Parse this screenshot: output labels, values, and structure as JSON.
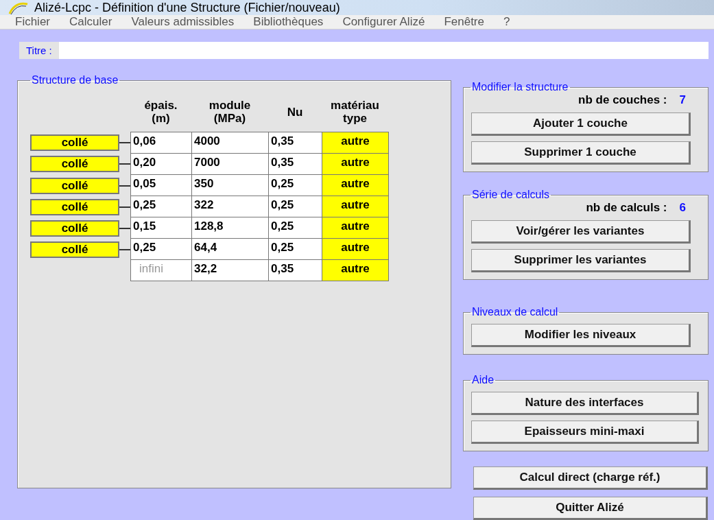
{
  "window": {
    "title": "Alizé-Lcpc - Définition d'une Structure (Fichier/nouveau)"
  },
  "menu": [
    "Fichier",
    "Calculer",
    "Valeurs admissibles",
    "Bibliothèques",
    "Configurer Alizé",
    "Fenêtre",
    "?"
  ],
  "title_field": {
    "label": "Titre :"
  },
  "structure": {
    "legend": "Structure de base",
    "columns": [
      {
        "line1": "épais.",
        "line2": "(m)"
      },
      {
        "line1": "module",
        "line2": "(MPa)"
      },
      {
        "line1": "Nu"
      },
      {
        "line1": "matériau",
        "line2": "type"
      }
    ],
    "layers": [
      {
        "thickness": "0,06",
        "disabled": false,
        "module": "4000",
        "nu": "0,35",
        "material": "autre"
      },
      {
        "thickness": "0,20",
        "disabled": false,
        "module": "7000",
        "nu": "0,35",
        "material": "autre"
      },
      {
        "thickness": "0,05",
        "disabled": false,
        "module": "350",
        "nu": "0,25",
        "material": "autre"
      },
      {
        "thickness": "0,25",
        "disabled": false,
        "module": "322",
        "nu": "0,25",
        "material": "autre"
      },
      {
        "thickness": "0,15",
        "disabled": false,
        "module": "128,8",
        "nu": "0,25",
        "material": "autre"
      },
      {
        "thickness": "0,25",
        "disabled": false,
        "module": "64,4",
        "nu": "0,25",
        "material": "autre"
      },
      {
        "thickness": "infini",
        "disabled": true,
        "module": "32,2",
        "nu": "0,35",
        "material": "autre"
      }
    ],
    "interfaces": [
      "collé",
      "collé",
      "collé",
      "collé",
      "collé",
      "collé"
    ]
  },
  "groups": [
    {
      "legend": "Modifier la structure",
      "count_label": "nb de couches :",
      "count": "7",
      "buttons": [
        "Ajouter 1 couche",
        "Supprimer 1 couche"
      ]
    },
    {
      "legend": "Série de calculs",
      "count_label": "nb de calculs :",
      "count": "6",
      "buttons": [
        "Voir/gérer les variantes",
        "Supprimer les variantes"
      ]
    },
    {
      "legend": "Niveaux de calcul",
      "buttons": [
        "Modifier les niveaux"
      ]
    },
    {
      "legend": "Aide",
      "buttons": [
        "Nature des interfaces",
        "Epaisseurs mini-maxi"
      ]
    }
  ],
  "buttons": [
    "Calcul direct (charge réf.)",
    "Quitter Alizé"
  ]
}
